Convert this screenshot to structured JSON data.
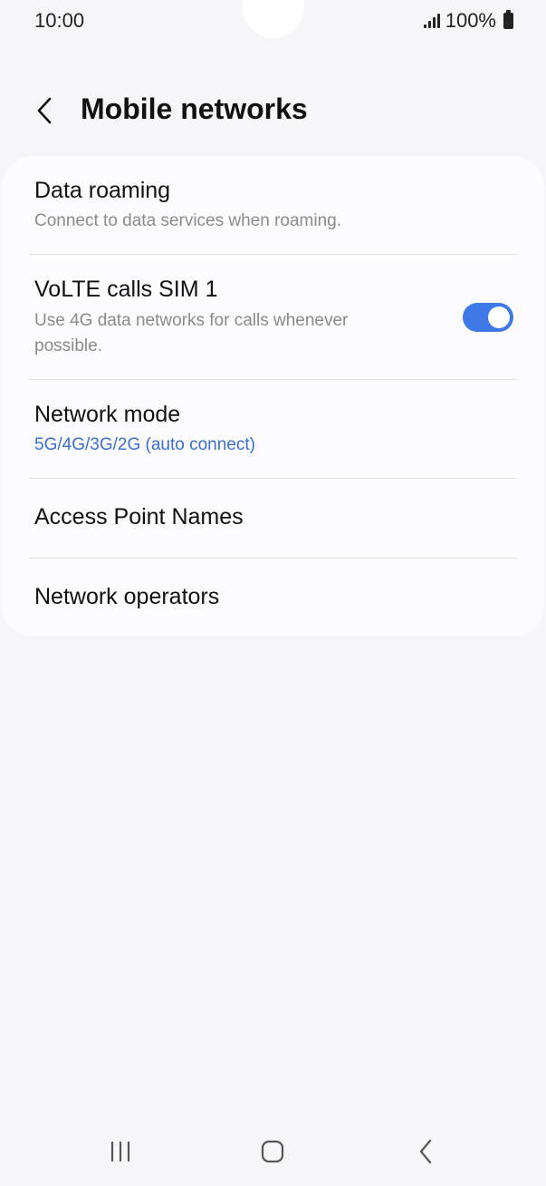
{
  "status_bar": {
    "time": "10:00",
    "battery": "100%"
  },
  "header": {
    "title": "Mobile networks"
  },
  "settings": {
    "data_roaming": {
      "title": "Data roaming",
      "subtitle": "Connect to data services when roaming."
    },
    "volte": {
      "title": "VoLTE calls SIM 1",
      "subtitle_line1": "Use 4G data networks for calls whenever",
      "subtitle_line2": "possible.",
      "enabled": true
    },
    "network_mode": {
      "title": "Network mode",
      "value": "5G/4G/3G/2G (auto connect)"
    },
    "access_point_names": {
      "title": "Access Point Names"
    },
    "network_operators": {
      "title": "Network operators"
    }
  },
  "colors": {
    "accent": "#3e78e6",
    "link": "#3a6fd0",
    "background": "#f6f6f8",
    "card": "#fcfcfe"
  },
  "icons": {
    "back": "chevron-left-icon",
    "recents": "recent-apps-icon",
    "home": "home-icon",
    "nav_back": "nav-back-icon"
  }
}
